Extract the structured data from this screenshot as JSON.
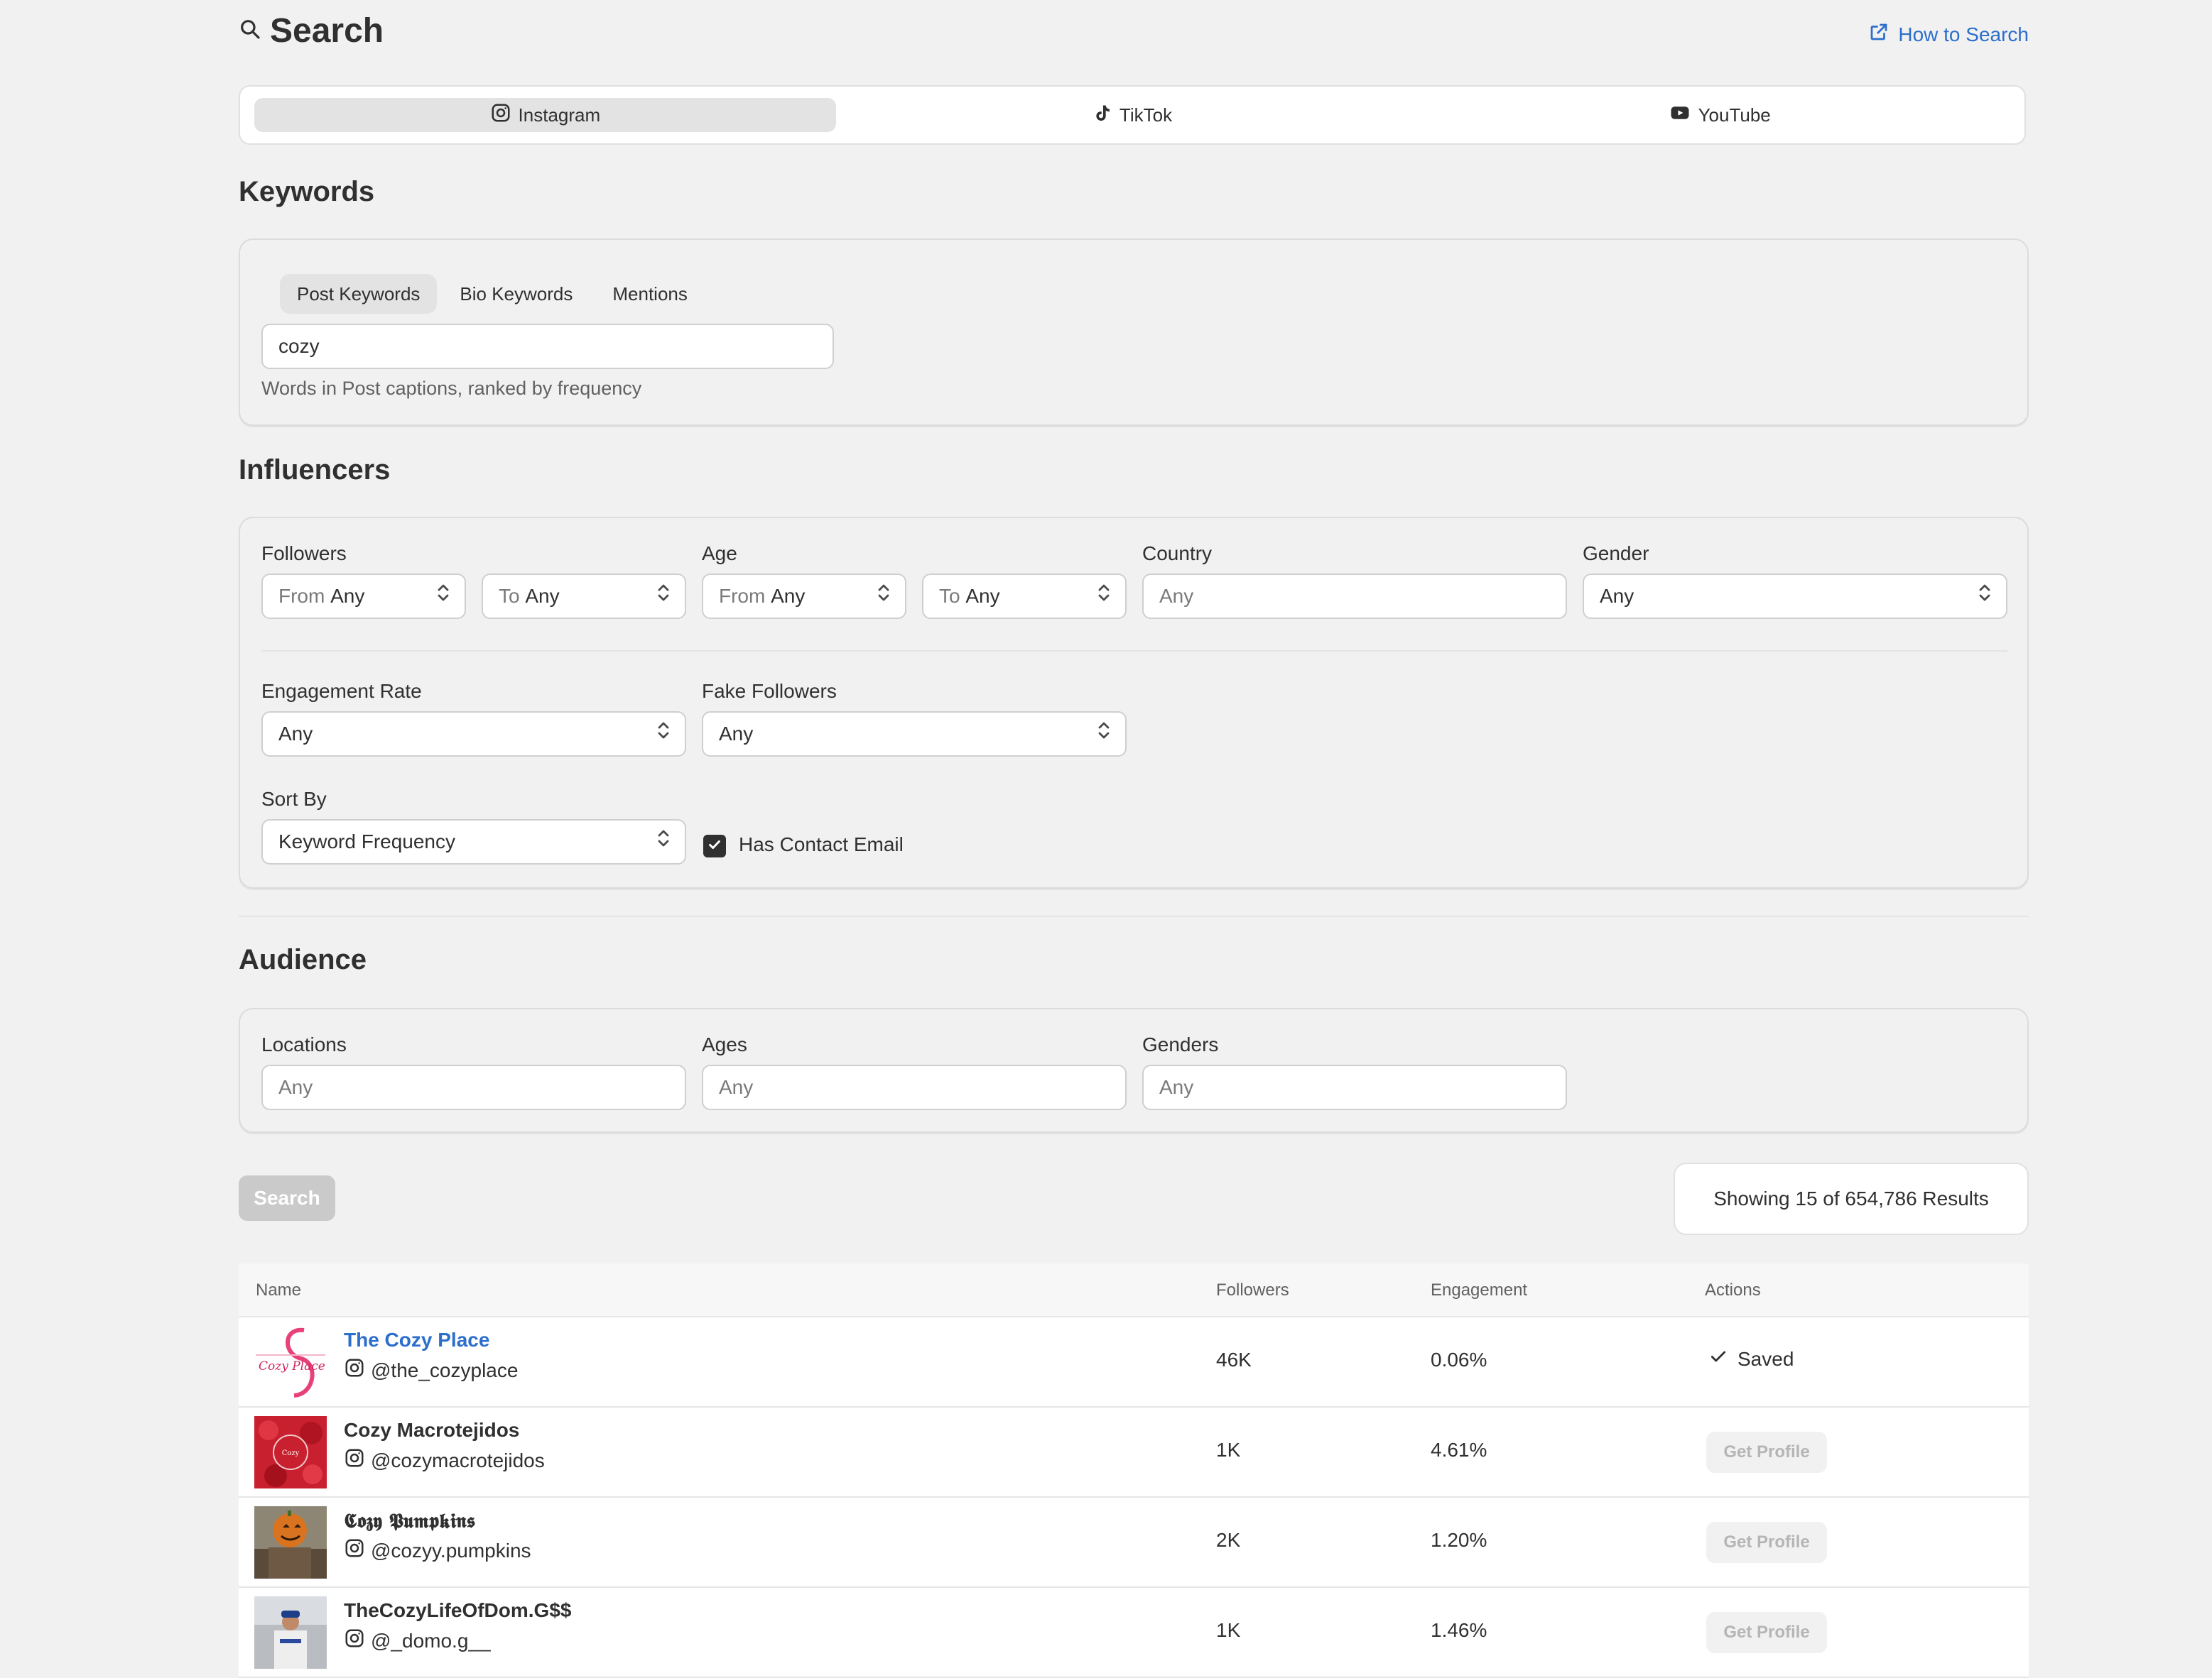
{
  "header": {
    "title": "Search",
    "how_to": "How to Search"
  },
  "platforms": [
    {
      "label": "Instagram",
      "icon": "instagram-icon",
      "active": true
    },
    {
      "label": "TikTok",
      "icon": "tiktok-icon",
      "active": false
    },
    {
      "label": "YouTube",
      "icon": "youtube-icon",
      "active": false
    }
  ],
  "keywords": {
    "heading": "Keywords",
    "tabs": [
      "Post Keywords",
      "Bio Keywords",
      "Mentions"
    ],
    "active_tab": "Post Keywords",
    "input_value": "cozy",
    "help": "Words in Post captions, ranked by frequency"
  },
  "influencers": {
    "heading": "Influencers",
    "followers_label": "Followers",
    "followers_from": {
      "prefix": "From",
      "value": "Any"
    },
    "followers_to": {
      "prefix": "To",
      "value": "Any"
    },
    "age_label": "Age",
    "age_from": {
      "prefix": "From",
      "value": "Any"
    },
    "age_to": {
      "prefix": "To",
      "value": "Any"
    },
    "country_label": "Country",
    "country_placeholder": "Any",
    "gender_label": "Gender",
    "gender_value": "Any",
    "engagement_label": "Engagement Rate",
    "engagement_value": "Any",
    "fake_label": "Fake Followers",
    "fake_value": "Any",
    "sort_label": "Sort By",
    "sort_value": "Keyword Frequency",
    "contact_email_label": "Has Contact Email",
    "contact_email_checked": true
  },
  "audience": {
    "heading": "Audience",
    "locations_label": "Locations",
    "locations_placeholder": "Any",
    "ages_label": "Ages",
    "ages_placeholder": "Any",
    "genders_label": "Genders",
    "genders_placeholder": "Any"
  },
  "search_button": "Search",
  "results_summary": "Showing 15 of 654,786 Results",
  "table": {
    "columns": [
      "Name",
      "Followers",
      "Engagement",
      "Actions"
    ],
    "rows": [
      {
        "name": "The Cozy Place",
        "handle": "@the_cozyplace",
        "followers": "46K",
        "engagement": "0.06%",
        "action": "Saved"
      },
      {
        "name": "Cozy Macrotejidos",
        "handle": "@cozymacrotejidos",
        "followers": "1K",
        "engagement": "4.61%",
        "action": "Get Profile"
      },
      {
        "name": "𝕮𝖔𝖟𝖞 𝕻𝖚𝖒𝖕𝖐𝖎𝖓𝖘",
        "handle": "@cozyy.pumpkins",
        "followers": "2K",
        "engagement": "1.20%",
        "action": "Get Profile"
      },
      {
        "name": "TheCozyLifeOfDom.G$$",
        "handle": "@_domo.g__",
        "followers": "1K",
        "engagement": "1.46%",
        "action": "Get Profile"
      }
    ]
  },
  "colors": {
    "accent": "#2c6ecb",
    "background": "#f1f1f1",
    "text": "#303030"
  }
}
